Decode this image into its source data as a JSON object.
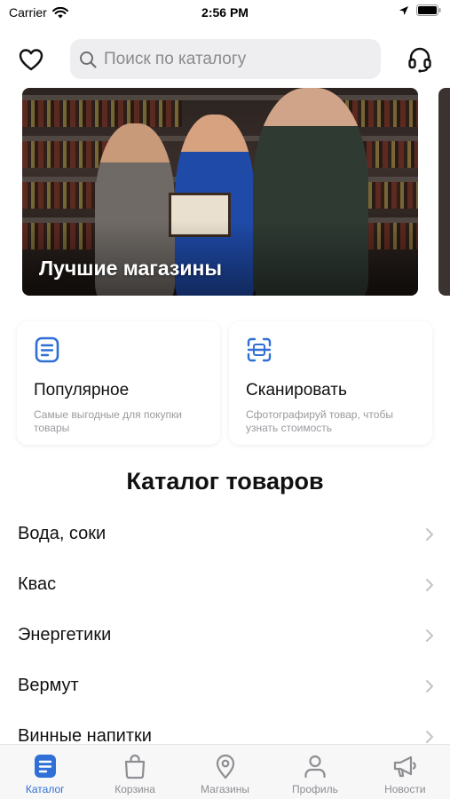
{
  "status_bar": {
    "carrier": "Carrier",
    "time": "2:56 PM"
  },
  "header": {
    "search_placeholder": "Поиск по каталогу"
  },
  "banner": {
    "title": "Лучшие магазины"
  },
  "quick_cards": [
    {
      "title": "Популярное",
      "subtitle": "Самые выгодные для покупки товары"
    },
    {
      "title": "Сканировать",
      "subtitle": "Сфотографируй товар, чтобы узнать стоимость"
    }
  ],
  "catalog": {
    "title": "Каталог товаров",
    "items": [
      {
        "label": "Вода, соки"
      },
      {
        "label": "Квас"
      },
      {
        "label": "Энергетики"
      },
      {
        "label": "Вермут"
      },
      {
        "label": "Винные напитки"
      }
    ]
  },
  "tab_bar": {
    "active_color": "#2f6fd6",
    "tabs": [
      {
        "label": "Каталог",
        "icon": "catalog-icon",
        "active": true
      },
      {
        "label": "Корзина",
        "icon": "bag-icon",
        "active": false
      },
      {
        "label": "Магазины",
        "icon": "location-pin-icon",
        "active": false
      },
      {
        "label": "Профиль",
        "icon": "profile-icon",
        "active": false
      },
      {
        "label": "Новости",
        "icon": "megaphone-icon",
        "active": false
      }
    ]
  }
}
